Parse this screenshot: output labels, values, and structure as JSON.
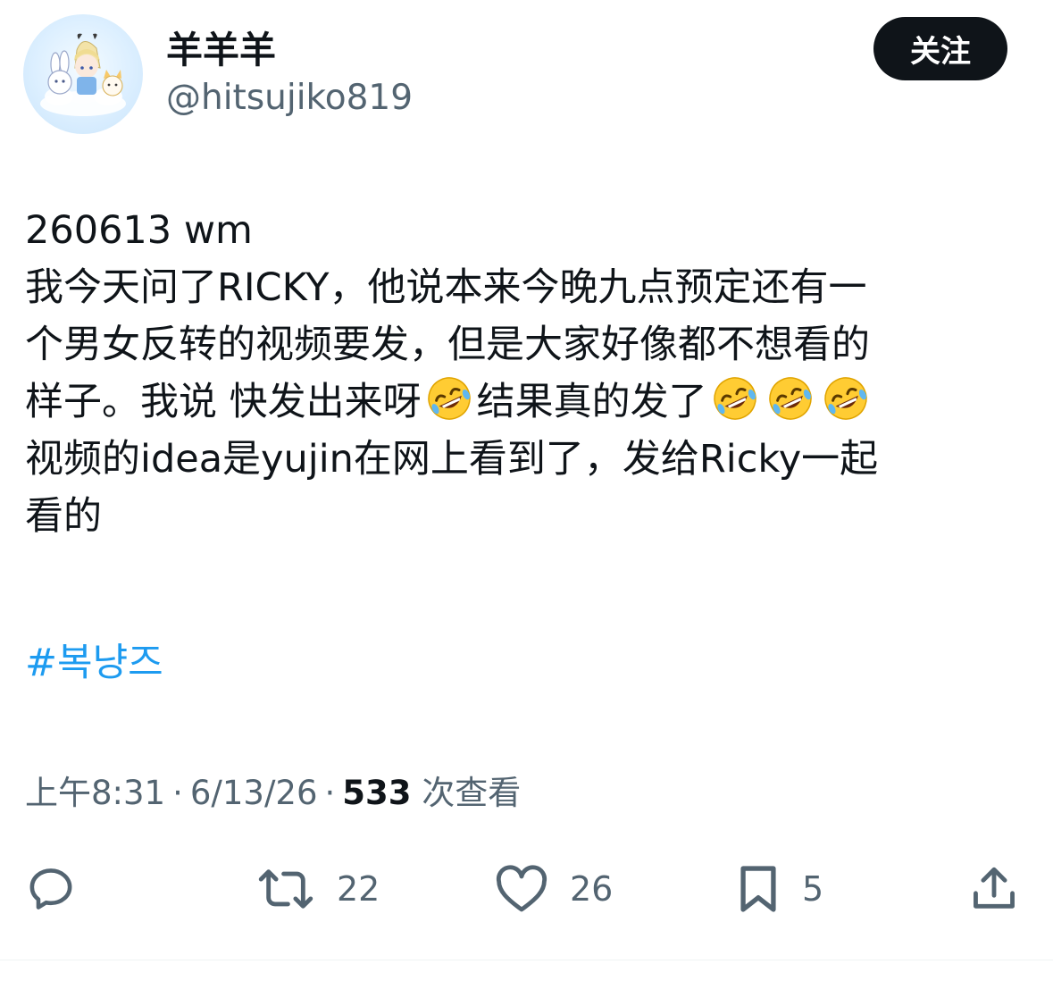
{
  "author": {
    "display_name": "羊羊羊",
    "handle": "@hitsujiko819",
    "avatar_icon": "avatar-illustration"
  },
  "follow_button": {
    "label": "关注"
  },
  "tweet": {
    "lines": [
      "260613 wm",
      "我今天问了RICKY，他说本来今晚九点预定还有一",
      "个男女反转的视频要发，但是大家好像都不想看的",
      "样子。我说 快发出来呀",
      "结果真的发了",
      "视频的idea是yujin在网上看到了，发给Ricky一起",
      "看的"
    ],
    "emoji": "🤣",
    "hashtag": "#복냥즈"
  },
  "meta": {
    "time": "上午8:31",
    "separator": "·",
    "date": "6/13/26",
    "views_count": "533",
    "views_label": "次查看"
  },
  "actions": {
    "reply": {
      "icon": "reply-icon"
    },
    "retweet": {
      "icon": "retweet-icon",
      "count": "22"
    },
    "like": {
      "icon": "heart-icon",
      "count": "26"
    },
    "bookmark": {
      "icon": "bookmark-icon",
      "count": "5"
    },
    "share": {
      "icon": "share-icon"
    }
  },
  "colors": {
    "text": "#0f1419",
    "secondary": "#536471",
    "link": "#1d9bf0",
    "button_bg": "#0f1419",
    "divider": "#eff3f4"
  }
}
